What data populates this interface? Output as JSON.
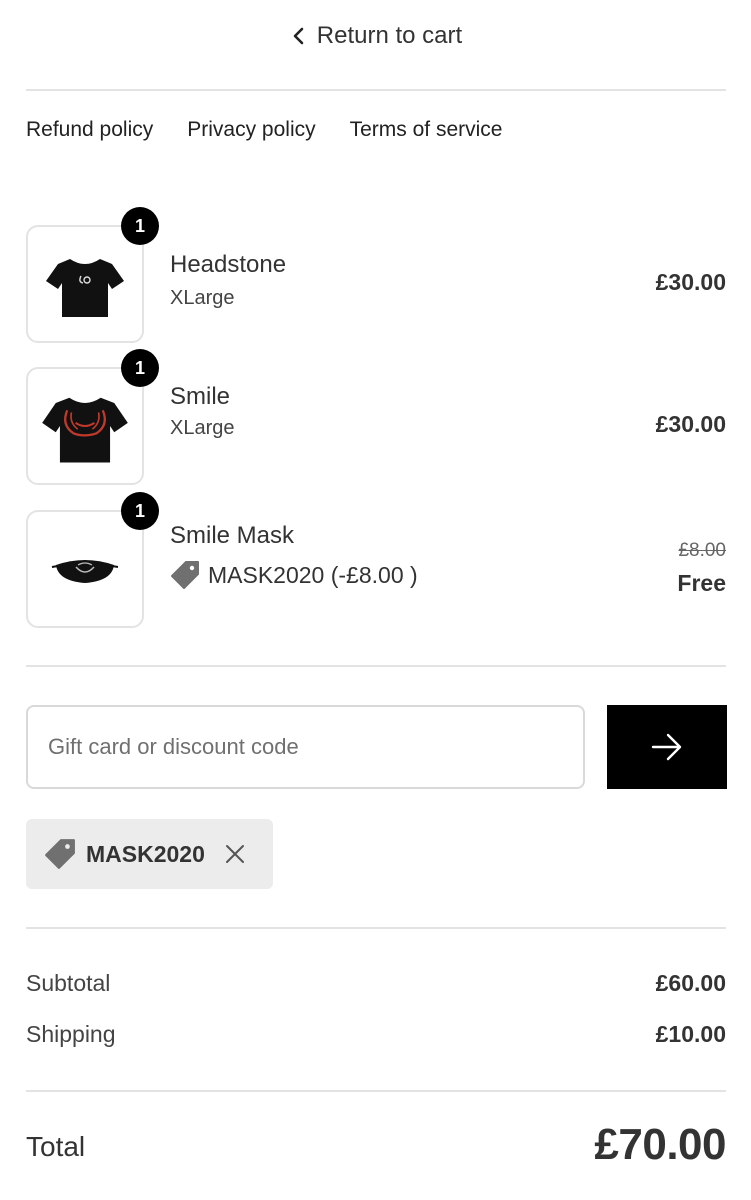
{
  "header": {
    "return_label": "Return to cart"
  },
  "policies": {
    "refund": "Refund policy",
    "privacy": "Privacy policy",
    "terms": "Terms of service"
  },
  "items": [
    {
      "name": "Headstone",
      "variant": "XLarge",
      "quantity": "1",
      "price": "£30.00",
      "image_icon": "black-tshirt-white-logo"
    },
    {
      "name": "Smile",
      "variant": "XLarge",
      "quantity": "1",
      "price": "£30.00",
      "image_icon": "black-tshirt-red-graphic"
    },
    {
      "name": "Smile Mask",
      "quantity": "1",
      "discount_text": "MASK2020 (-£8.00 )",
      "original_price": "£8.00",
      "price": "Free",
      "image_icon": "black-face-mask"
    }
  ],
  "discount": {
    "placeholder": "Gift card or discount code",
    "value": "",
    "applied_code": "MASK2020"
  },
  "totals": {
    "subtotal_label": "Subtotal",
    "subtotal_value": "£60.00",
    "shipping_label": "Shipping",
    "shipping_value": "£10.00",
    "total_label": "Total",
    "total_value": "£70.00"
  },
  "colors": {
    "accent": "#000000",
    "divider": "#e3e3e3",
    "chip_bg": "#ececec",
    "tag_icon": "#707070"
  }
}
